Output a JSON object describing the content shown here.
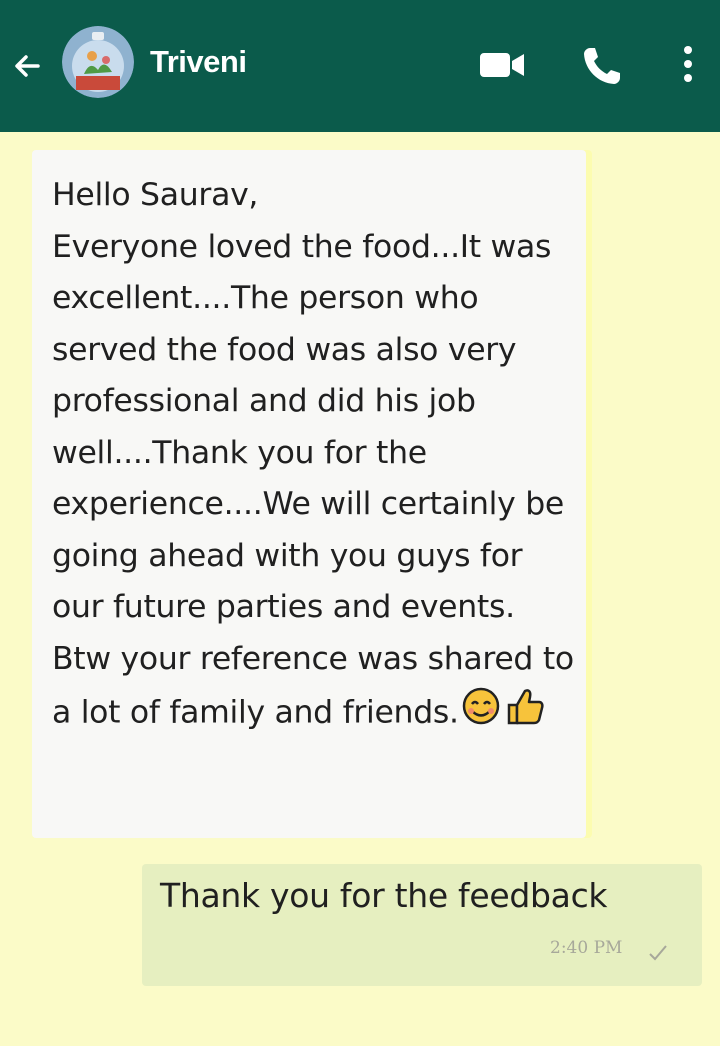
{
  "header": {
    "contact_name": "Triveni",
    "icons": [
      "back-arrow-icon",
      "video-call-icon",
      "phone-icon",
      "more-options-icon"
    ],
    "bg_color": "#0b5b4b"
  },
  "messages": [
    {
      "direction": "incoming",
      "text": "Hello Saurav,\nEveryone loved the food...It was excellent....The person who served the food was also very professional and did his job well....Thank you for the experience....We will certainly be going ahead with you guys for our future parties and events.\nBtw your reference was shared to a lot of family and friends.",
      "emojis": [
        "smiling-face-emoji",
        "thumbs-up-emoji"
      ]
    },
    {
      "direction": "outgoing",
      "text": "Thank you for the feedback",
      "time": "2:40 PM",
      "status_icon": "single-tick-icon"
    }
  ],
  "colors": {
    "chat_bg": "#fbfbc8",
    "incoming_bubble": "#f8f8f6",
    "outgoing_bubble": "#e6efc0"
  }
}
